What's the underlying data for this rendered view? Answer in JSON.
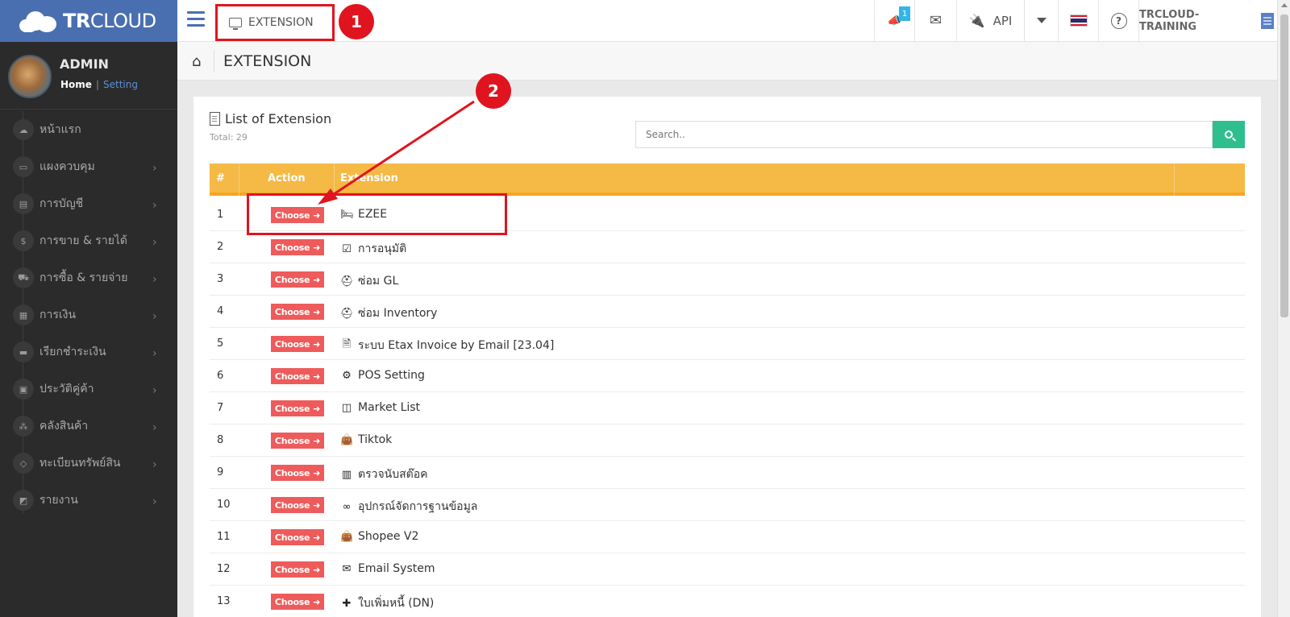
{
  "brand": {
    "bold": "TR",
    "rest": "CLOUD"
  },
  "profile": {
    "name": "ADMIN",
    "home_link": "Home",
    "setting_link": "Setting"
  },
  "sidebar": {
    "items": [
      {
        "label": "หน้าแรก",
        "icon": "cloud-icon",
        "has_arrow": false
      },
      {
        "label": "แผงควบคุม",
        "icon": "monitor-icon",
        "has_arrow": true
      },
      {
        "label": "การบัญชี",
        "icon": "book-icon",
        "has_arrow": true
      },
      {
        "label": "การขาย & รายได้",
        "icon": "dollar-icon",
        "has_arrow": true
      },
      {
        "label": "การซื้อ & รายจ่าย",
        "icon": "cart-icon",
        "has_arrow": true
      },
      {
        "label": "การเงิน",
        "icon": "calendar-icon",
        "has_arrow": true
      },
      {
        "label": "เรียกชำระเงิน",
        "icon": "credit-card-icon",
        "has_arrow": true
      },
      {
        "label": "ประวัติคู่ค้า",
        "icon": "contact-icon",
        "has_arrow": true
      },
      {
        "label": "คลังสินค้า",
        "icon": "cubes-icon",
        "has_arrow": true
      },
      {
        "label": "ทะเบียนทรัพย์สิน",
        "icon": "diamond-icon",
        "has_arrow": true
      },
      {
        "label": "รายงาน",
        "icon": "report-icon",
        "has_arrow": true
      }
    ]
  },
  "topbar": {
    "tab_label": "EXTENSION",
    "notification_count": "1",
    "api_label": "API",
    "company": "TRCLOUD-TRAINING"
  },
  "breadcrumb": {
    "title": "EXTENSION"
  },
  "panel": {
    "title": "List of Extension",
    "total": "Total: 29",
    "search_placeholder": "Search..",
    "headers": {
      "num": "#",
      "action": "Action",
      "extension": "Extension"
    },
    "choose_label": "Choose"
  },
  "rows": [
    {
      "num": "1",
      "icon": "bed-icon",
      "glyph": "🛏",
      "name": "EZEE"
    },
    {
      "num": "2",
      "icon": "check-square-icon",
      "glyph": "☑",
      "name": "การอนุมัติ"
    },
    {
      "num": "3",
      "icon": "lifebuoy-icon",
      "glyph": "⛑",
      "name": "ซ่อม GL"
    },
    {
      "num": "4",
      "icon": "lifebuoy-icon",
      "glyph": "⛑",
      "name": "ซ่อม Inventory"
    },
    {
      "num": "5",
      "icon": "file-icon",
      "glyph": "🗎",
      "name": "ระบบ Etax Invoice by Email [23.04]"
    },
    {
      "num": "6",
      "icon": "cogs-icon",
      "glyph": "⚙",
      "name": "POS Setting"
    },
    {
      "num": "7",
      "icon": "columns-icon",
      "glyph": "◫",
      "name": "Market List"
    },
    {
      "num": "8",
      "icon": "shopping-bag-icon",
      "glyph": "👜",
      "name": "Tiktok"
    },
    {
      "num": "9",
      "icon": "barcode-icon",
      "glyph": "▥",
      "name": "ตรวจนับสต๊อค"
    },
    {
      "num": "10",
      "icon": "link-icon",
      "glyph": "∞",
      "name": "อุปกรณ์จัดการฐานข้อมูล"
    },
    {
      "num": "11",
      "icon": "shopping-bag-icon",
      "glyph": "👜",
      "name": "Shopee V2"
    },
    {
      "num": "12",
      "icon": "envelope-icon",
      "glyph": "✉",
      "name": "Email System"
    },
    {
      "num": "13",
      "icon": "plus-icon",
      "glyph": "✚",
      "name": "ใบเพิ่มหนี้ (DN)"
    }
  ],
  "annotations": {
    "step1": "1",
    "step2": "2"
  },
  "colors": {
    "brand": "#4a6fb0",
    "sidebar": "#2b2b2b",
    "table_header": "#f5b945",
    "choose_button": "#ee5b5b",
    "search_button": "#2fbf8f",
    "annotation": "#e0141e"
  }
}
